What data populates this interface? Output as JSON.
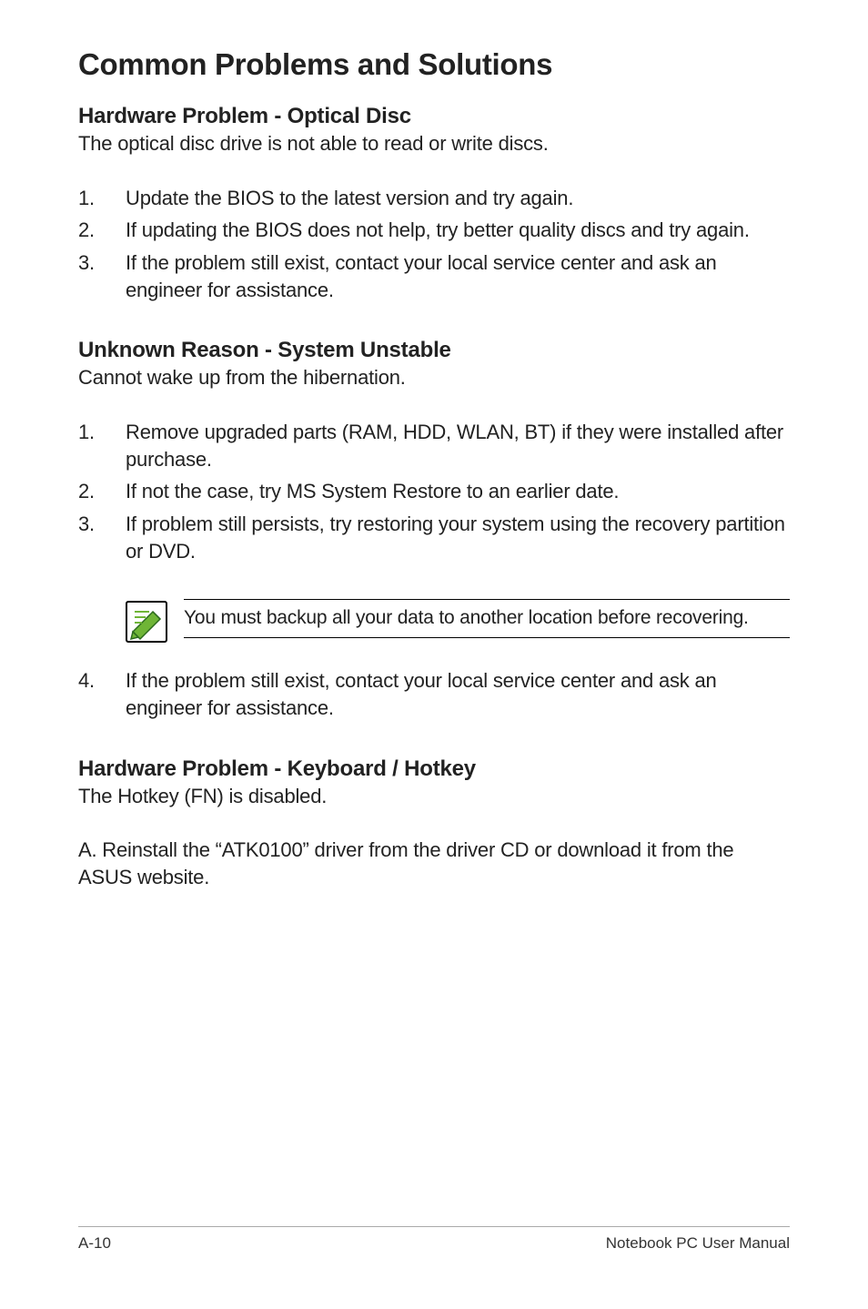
{
  "title": "Common Problems and Solutions",
  "sections": {
    "s1": {
      "heading": "Hardware Problem - Optical Disc",
      "intro": "The optical disc drive is not able to read or write discs.",
      "items": [
        "Update the BIOS to the latest version and try again.",
        "If updating the BIOS does not help, try better quality discs and try again.",
        "If the problem still exist, contact your local service center and ask an engineer for assistance."
      ]
    },
    "s2": {
      "heading": "Unknown Reason - System Unstable",
      "intro": "Cannot wake up from the hibernation.",
      "items_a": [
        "Remove upgraded parts (RAM, HDD, WLAN, BT) if they were installed after purchase.",
        "If not the case, try MS System Restore to an earlier date.",
        "If problem still persists, try restoring your system using the recovery partition or DVD."
      ],
      "note": "You must backup all your data to another location before recovering.",
      "items_b": [
        "If the problem still exist, contact your local service center and ask an engineer for assistance."
      ]
    },
    "s3": {
      "heading": "Hardware Problem - Keyboard / Hotkey",
      "intro": "The Hotkey (FN) is disabled.",
      "body": "A. Reinstall the “ATK0100” driver from the driver CD or download it from the ASUS website."
    }
  },
  "numbers": {
    "n1": "1.",
    "n2": "2.",
    "n3": "3.",
    "n4": "4."
  },
  "footer": {
    "left": "A-10",
    "right": "Notebook PC User Manual"
  }
}
